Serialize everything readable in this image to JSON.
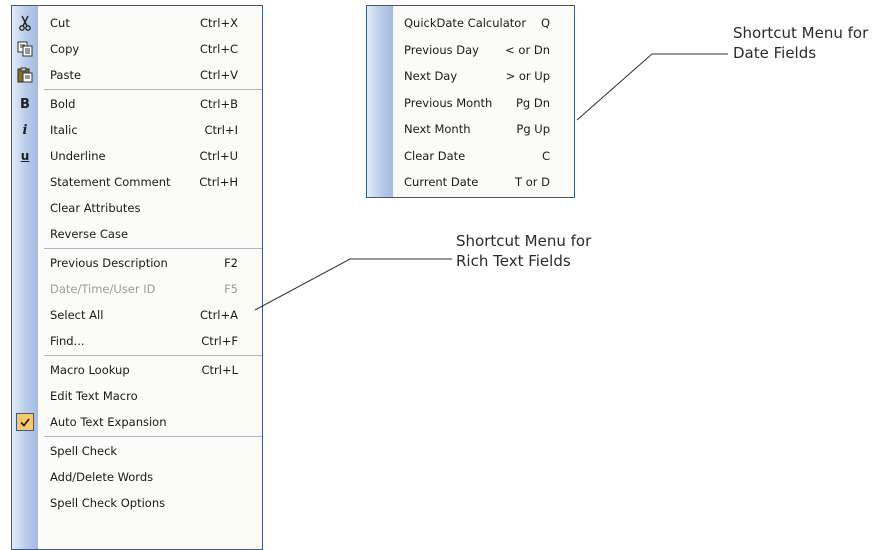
{
  "rich_text_menu": {
    "items": [
      {
        "label": "Cut",
        "shortcut": "Ctrl+X",
        "icon": "scissors-icon"
      },
      {
        "label": "Copy",
        "shortcut": "Ctrl+C",
        "icon": "copy-icon"
      },
      {
        "label": "Paste",
        "shortcut": "Ctrl+V",
        "icon": "paste-icon"
      },
      {
        "label": "Bold",
        "shortcut": "Ctrl+B",
        "icon": "bold-icon"
      },
      {
        "label": "Italic",
        "shortcut": "Ctrl+I",
        "icon": "italic-icon"
      },
      {
        "label": "Underline",
        "shortcut": "Ctrl+U",
        "icon": "underline-icon"
      },
      {
        "label": "Statement Comment",
        "shortcut": "Ctrl+H"
      },
      {
        "label": "Clear Attributes",
        "shortcut": ""
      },
      {
        "label": "Reverse Case",
        "shortcut": ""
      },
      {
        "label": "Previous Description",
        "shortcut": "F2"
      },
      {
        "label": "Date/Time/User ID",
        "shortcut": "F5",
        "disabled": true
      },
      {
        "label": "Select All",
        "shortcut": "Ctrl+A"
      },
      {
        "label": "Find...",
        "shortcut": "Ctrl+F"
      },
      {
        "label": "Macro Lookup",
        "shortcut": "Ctrl+L"
      },
      {
        "label": "Edit Text Macro",
        "shortcut": ""
      },
      {
        "label": "Auto Text Expansion",
        "shortcut": "",
        "checked": true
      },
      {
        "label": "Spell Check",
        "shortcut": ""
      },
      {
        "label": "Add/Delete Words",
        "shortcut": ""
      },
      {
        "label": "Spell Check Options",
        "shortcut": ""
      }
    ],
    "icon_glyphs": {
      "bold-icon": "B",
      "italic-icon": "i",
      "underline-icon": "u"
    }
  },
  "date_menu": {
    "items": [
      {
        "label": "QuickDate Calculator",
        "shortcut": "Q"
      },
      {
        "label": "Previous Day",
        "shortcut": "< or Dn"
      },
      {
        "label": "Next Day",
        "shortcut": "> or Up"
      },
      {
        "label": "Previous Month",
        "shortcut": "Pg Dn"
      },
      {
        "label": "Next Month",
        "shortcut": "Pg Up"
      },
      {
        "label": "Clear Date",
        "shortcut": "C"
      },
      {
        "label": "Current Date",
        "shortcut": "T or D"
      }
    ]
  },
  "callouts": {
    "date": {
      "line1": "Shortcut Menu for",
      "line2": "Date Fields"
    },
    "rich": {
      "line1": "Shortcut Menu for",
      "line2": "Rich Text Fields"
    }
  },
  "colors": {
    "menu_border": "#3b5a8a",
    "gutter": "#b8cbea",
    "check_highlight": "#f9c86a",
    "disabled_text": "#9c9c9c"
  }
}
